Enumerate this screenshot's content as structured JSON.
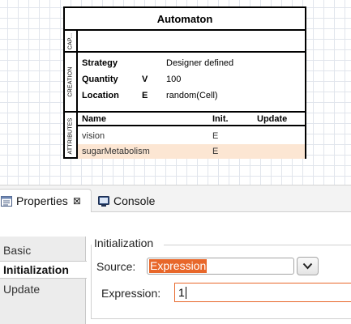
{
  "diagram": {
    "title": "Automaton",
    "sections": {
      "cap_label": "CAP...",
      "creation_label": "CREATION",
      "attributes_label": "ATTRIBUTES"
    },
    "creation": [
      {
        "name": "Strategy",
        "type": "",
        "value": "Designer defined"
      },
      {
        "name": "Quantity",
        "type": "V",
        "value": "100"
      },
      {
        "name": "Location",
        "type": "E",
        "value": "random(Cell)"
      }
    ],
    "attributes": {
      "headers": {
        "name": "Name",
        "init": "Init.",
        "update": "Update"
      },
      "rows": [
        {
          "name": "vision",
          "init": "E",
          "update": ""
        },
        {
          "name": "sugarMetabolism",
          "init": "E",
          "update": ""
        }
      ]
    },
    "highlight_color": "#fce6d3"
  },
  "tabs": [
    {
      "label": "Properties",
      "icon": "properties-icon",
      "close": "⊠"
    },
    {
      "label": "Console",
      "icon": "console-icon"
    }
  ],
  "side_tabs": [
    "Basic",
    "Initialization",
    "Update"
  ],
  "form": {
    "group_title": "Initialization",
    "source_label": "Source:",
    "source_value": "Expression",
    "expression_label": "Expression:",
    "expression_value": "1"
  },
  "colors": {
    "accent": "#e8672a"
  }
}
